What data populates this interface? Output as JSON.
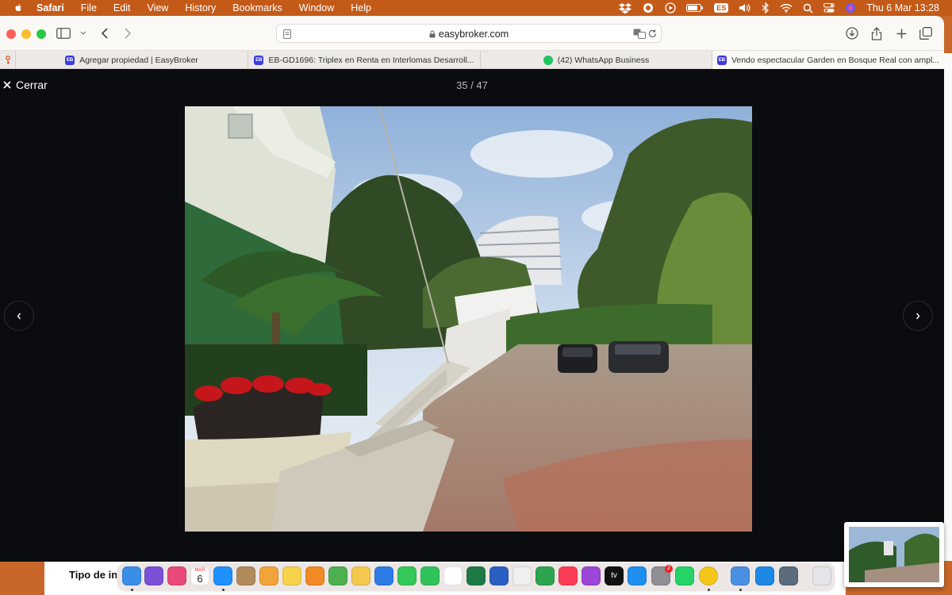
{
  "menubar": {
    "app_name": "Safari",
    "items": [
      "File",
      "Edit",
      "View",
      "History",
      "Bookmarks",
      "Window",
      "Help"
    ],
    "input_source": "ES",
    "clock": "Thu 6 Mar  13:28"
  },
  "safari": {
    "url": "easybroker.com",
    "tabs": [
      {
        "title": "Agregar propiedad | EasyBroker",
        "favicon": "easybroker-icon",
        "active": false
      },
      {
        "title": "EB-GD1696: Triplex en Renta en Interlomas Desarroll...",
        "favicon": "easybroker-icon",
        "active": false
      },
      {
        "title": "(42) WhatsApp Business",
        "favicon": "whatsapp-icon",
        "active": false
      },
      {
        "title": "Vendo espectacular Garden en Bosque Real con ampl...",
        "favicon": "easybroker-icon",
        "active": true
      }
    ]
  },
  "gallery": {
    "close_label": "Cerrar",
    "counter": "35 / 47"
  },
  "background_page": {
    "field_label": "Tipo de in"
  },
  "dock": {
    "apps": [
      "finder-icon",
      "siri-icon",
      "launchpad-icon",
      "calendar-icon",
      "safari-icon",
      "contacts-icon",
      "photos-icon",
      "notes-icon",
      "books-icon",
      "maps-icon",
      "pages-icon",
      "keynote-icon",
      "messages-icon",
      "facetime-icon",
      "reminders-icon",
      "excel-icon",
      "word-icon",
      "photos-library-icon",
      "numbers-icon",
      "music-icon",
      "podcasts-icon",
      "tv-icon",
      "app-store-icon",
      "system-settings-icon",
      "whatsapp-icon",
      "chrome-icon",
      "preview-icon",
      "mail-icon",
      "network-icon",
      "trash-icon"
    ],
    "calendar_day": "6",
    "calendar_month": "MAR",
    "settings_badge": "2",
    "tv_label": "tv"
  },
  "colors": {
    "menubar": "#c45a18",
    "gallery_bg": "#0b0c0f",
    "easybroker_brand": "#3b3be0",
    "whatsapp_brand": "#22c35e"
  }
}
